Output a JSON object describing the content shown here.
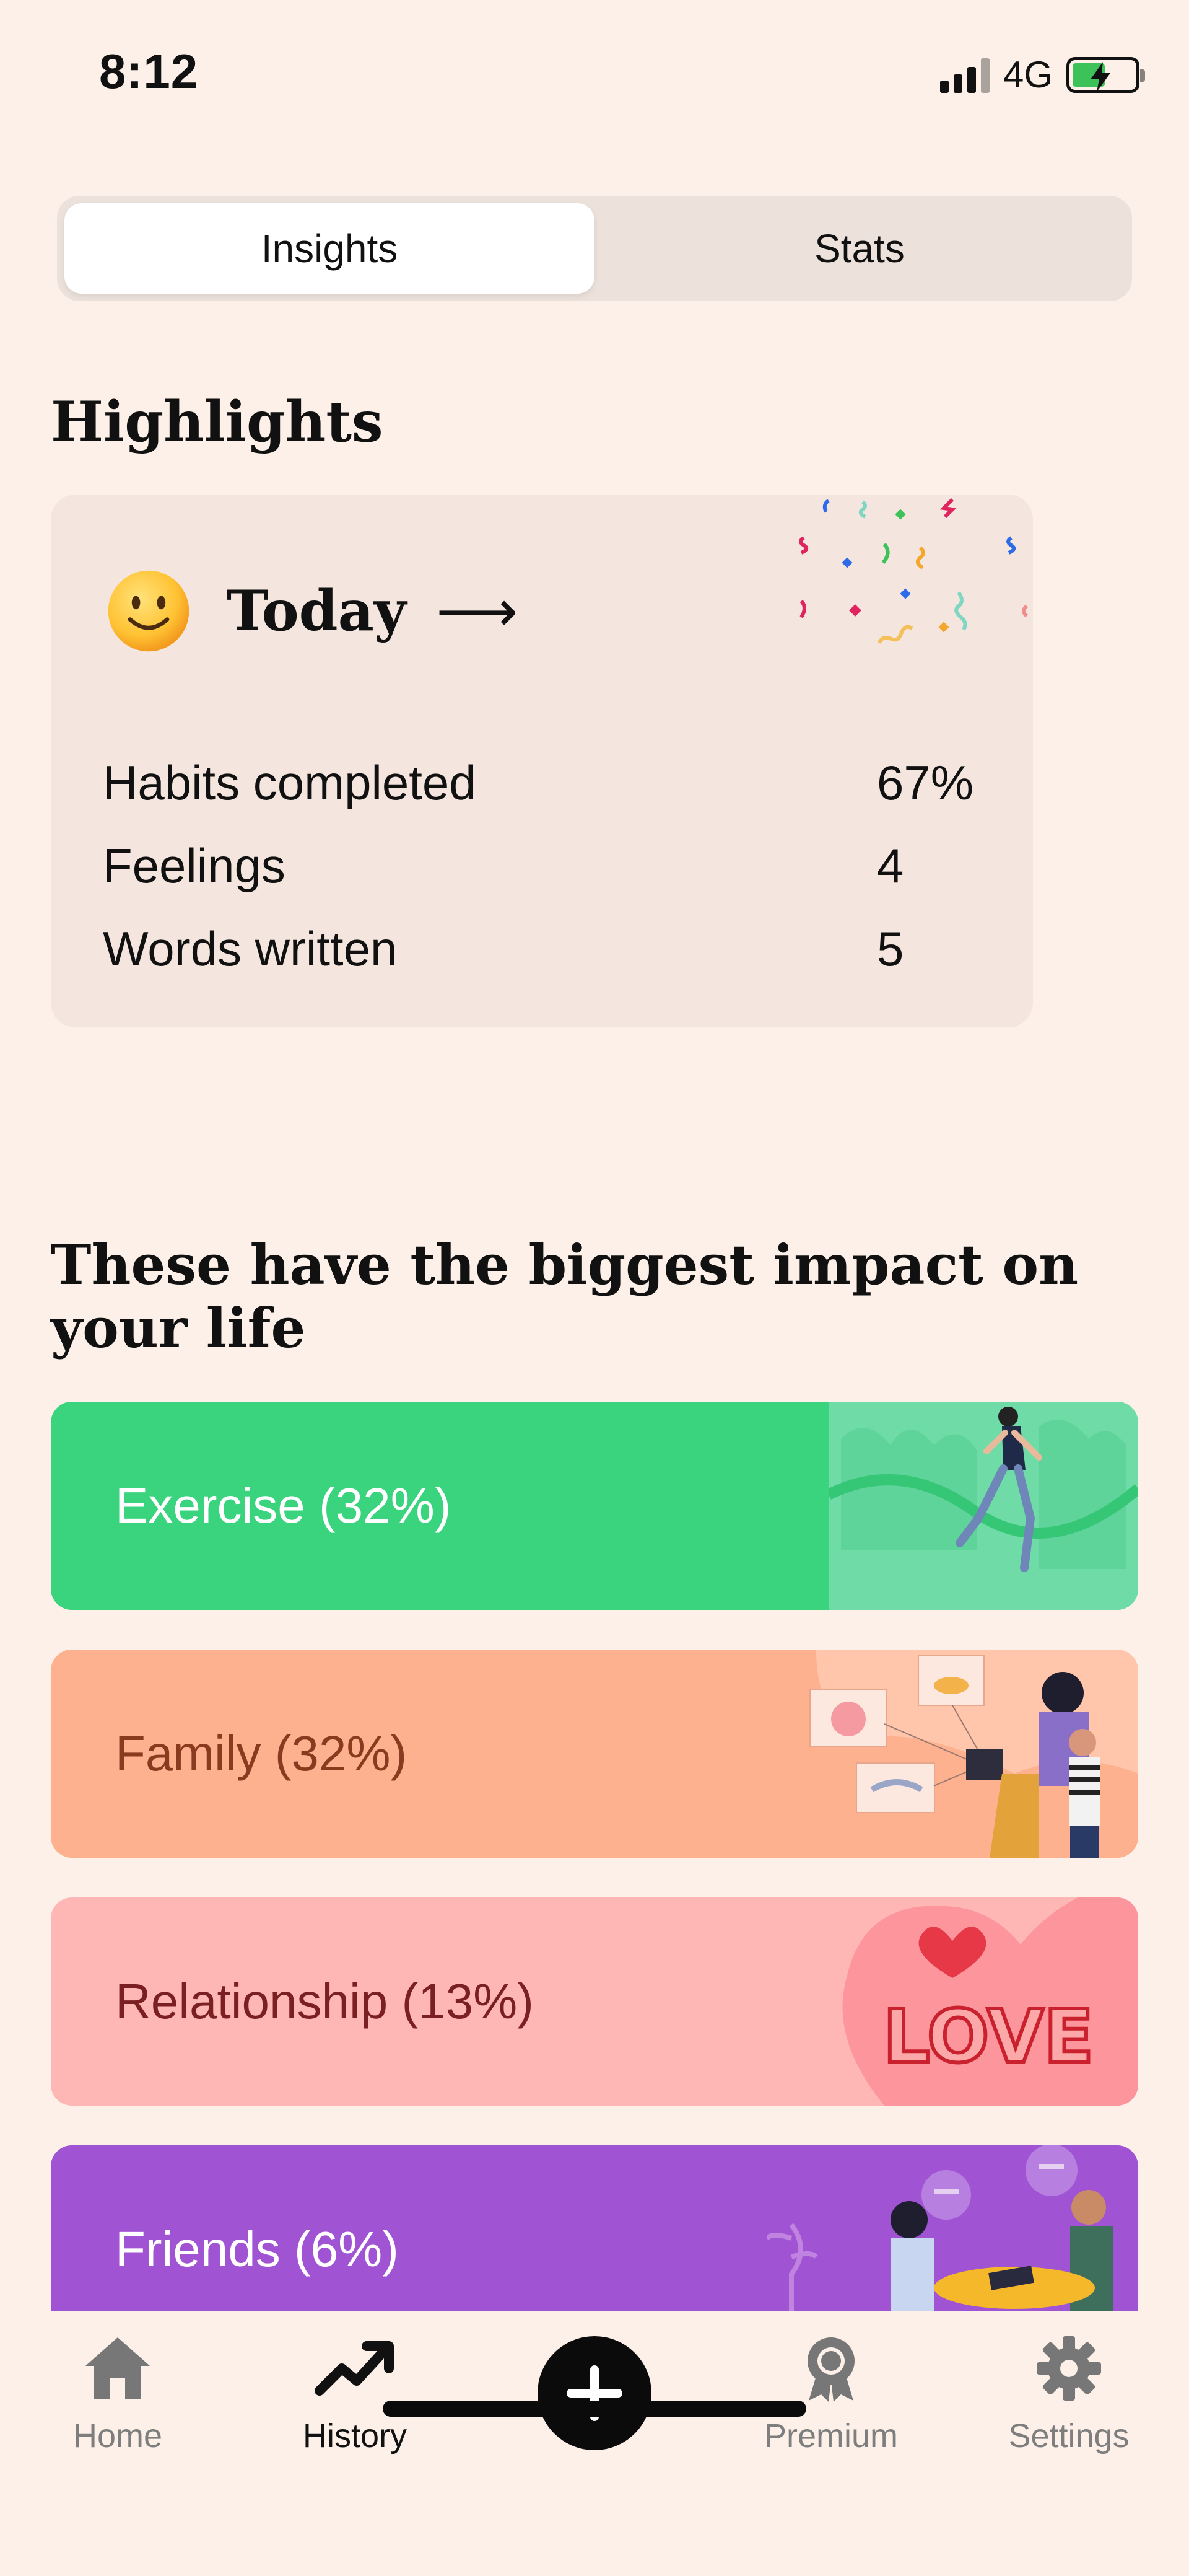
{
  "status_bar": {
    "time": "8:12",
    "network": "4G"
  },
  "segment": {
    "tabs": [
      "Insights",
      "Stats"
    ],
    "active": "Insights"
  },
  "highlights": {
    "title": "Highlights",
    "today_label": "Today",
    "arrow": "⟶",
    "stats": [
      {
        "label": "Habits completed",
        "value": "67%"
      },
      {
        "label": "Feelings",
        "value": "4"
      },
      {
        "label": "Words written",
        "value": "5"
      }
    ]
  },
  "impact": {
    "title": "These have the biggest impact on your life",
    "items": [
      {
        "label": "Exercise (32%)",
        "color": "#3BD47E",
        "text_color": "#FFFFFF"
      },
      {
        "label": "Family (32%)",
        "color": "#FEB18E",
        "text_color": "#8A3A1E"
      },
      {
        "label": "Relationship (13%)",
        "color": "#FEB7B5",
        "text_color": "#7A1F22"
      },
      {
        "label": "Friends (6%)",
        "color": "#A053D2",
        "text_color": "#FFFFFF"
      }
    ]
  },
  "tabbar": {
    "items": [
      {
        "label": "Home",
        "icon": "home-icon"
      },
      {
        "label": "History",
        "icon": "trend-up-icon",
        "active": true
      },
      {
        "label": "",
        "icon": "plus-icon"
      },
      {
        "label": "Premium",
        "icon": "award-icon"
      },
      {
        "label": "Settings",
        "icon": "gear-icon"
      }
    ]
  }
}
